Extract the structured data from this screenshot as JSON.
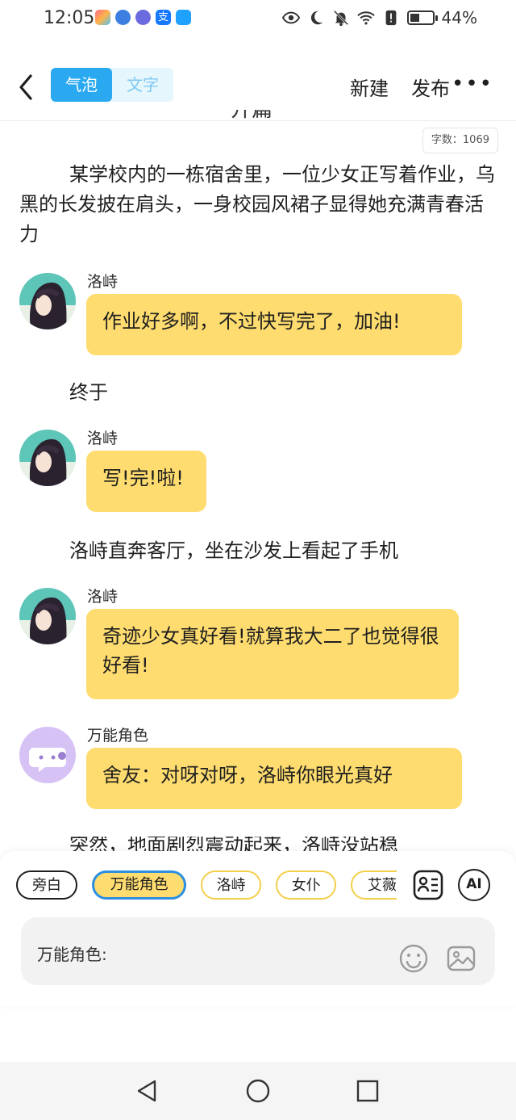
{
  "status_bar": {
    "time": "12:05",
    "battery_text": "44%",
    "battery_level": 0.44,
    "app_icons": [
      "appstore-icon",
      "browser-icon",
      "music-icon",
      "alipay-icon",
      "search-app-icon"
    ],
    "indicators": [
      "eye-icon",
      "moon-icon",
      "bell-off-icon",
      "wifi-icon",
      "alert-icon",
      "battery-icon"
    ]
  },
  "header": {
    "tabs": [
      {
        "label": "气泡",
        "active": true
      },
      {
        "label": "文字",
        "active": false
      }
    ],
    "new_label": "新建",
    "publish_label": "发布",
    "more_icon": "more-icon"
  },
  "editor": {
    "title_partial": "开篇",
    "word_count": "字数：1069",
    "blocks": [
      {
        "type": "narration",
        "text": "某学校内的一栋宿舍里，一位少女正写着作业，乌黑的长发披在肩头，一身校园风裙子显得她充满青春活力"
      },
      {
        "type": "message",
        "name": "洛峙",
        "text": "作业好多啊，不过快写完了，加油!"
      },
      {
        "type": "narration",
        "text": "终于"
      },
      {
        "type": "message",
        "name": "洛峙",
        "text": "写!完!啦!"
      },
      {
        "type": "narration",
        "text": "洛峙直奔客厅，坐在沙发上看起了手机"
      },
      {
        "type": "message",
        "name": "洛峙",
        "text": "奇迹少女真好看!就算我大二了也觉得很好看!"
      },
      {
        "type": "message",
        "name": "万能角色",
        "text": "舍友：对呀对呀，洛峙你眼光真好"
      },
      {
        "type": "narration",
        "text": "突然，地面剧烈震动起来，洛峙没站稳"
      }
    ]
  },
  "composer": {
    "roles": [
      {
        "label": "旁白",
        "style": "plain"
      },
      {
        "label": "万能角色",
        "style": "active"
      },
      {
        "label": "洛峙",
        "style": "yellow"
      },
      {
        "label": "女仆",
        "style": "yellow"
      },
      {
        "label": "艾薇拉",
        "style": "yellow"
      }
    ],
    "ai_label": "AI",
    "input_label": "万能角色:",
    "icons": [
      "role-card-icon",
      "ai-icon",
      "emoji-icon",
      "image-icon"
    ]
  },
  "nav_bar": {
    "icons": [
      "back-triangle-icon",
      "home-circle-icon",
      "recents-square-icon"
    ]
  },
  "colors": {
    "accent_blue": "#2aa9f0",
    "bubble_yellow": "#fedc6f",
    "chip_active_border": "#2c8fe0",
    "avatar_universal": "#d7c2f5"
  }
}
